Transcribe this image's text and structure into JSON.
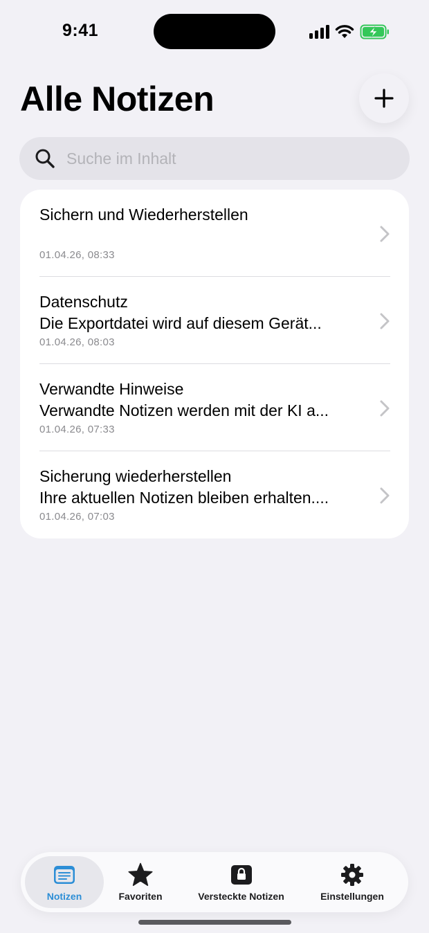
{
  "status_bar": {
    "time": "9:41",
    "icons": [
      "cellular-signal-icon",
      "wifi-icon",
      "battery-charging-icon"
    ],
    "battery_color": "#34c759"
  },
  "header": {
    "title": "Alle Notizen",
    "add_icon": "plus-icon"
  },
  "search": {
    "placeholder": "Suche im Inhalt",
    "value": "",
    "icon": "search-icon"
  },
  "notes": [
    {
      "title": "Sichern und Wiederherstellen",
      "preview": "",
      "date": "01.04.26, 08:33"
    },
    {
      "title": "Datenschutz",
      "preview": "Die Exportdatei wird auf diesem Gerät...",
      "date": "01.04.26, 08:03"
    },
    {
      "title": "Verwandte Hinweise",
      "preview": "Verwandte Notizen werden mit der KI a...",
      "date": "01.04.26, 07:33"
    },
    {
      "title": "Sicherung wiederherstellen",
      "preview": "Ihre aktuellen Notizen bleiben erhalten....",
      "date": "01.04.26, 07:03"
    }
  ],
  "tab_bar": {
    "active_color": "#2c8ed6",
    "tabs": [
      {
        "label": "Notizen",
        "icon": "notes-icon",
        "active": true
      },
      {
        "label": "Favoriten",
        "icon": "star-icon",
        "active": false
      },
      {
        "label": "Versteckte Notizen",
        "icon": "lock-icon",
        "active": false
      },
      {
        "label": "Einstellungen",
        "icon": "gear-icon",
        "active": false
      }
    ]
  }
}
